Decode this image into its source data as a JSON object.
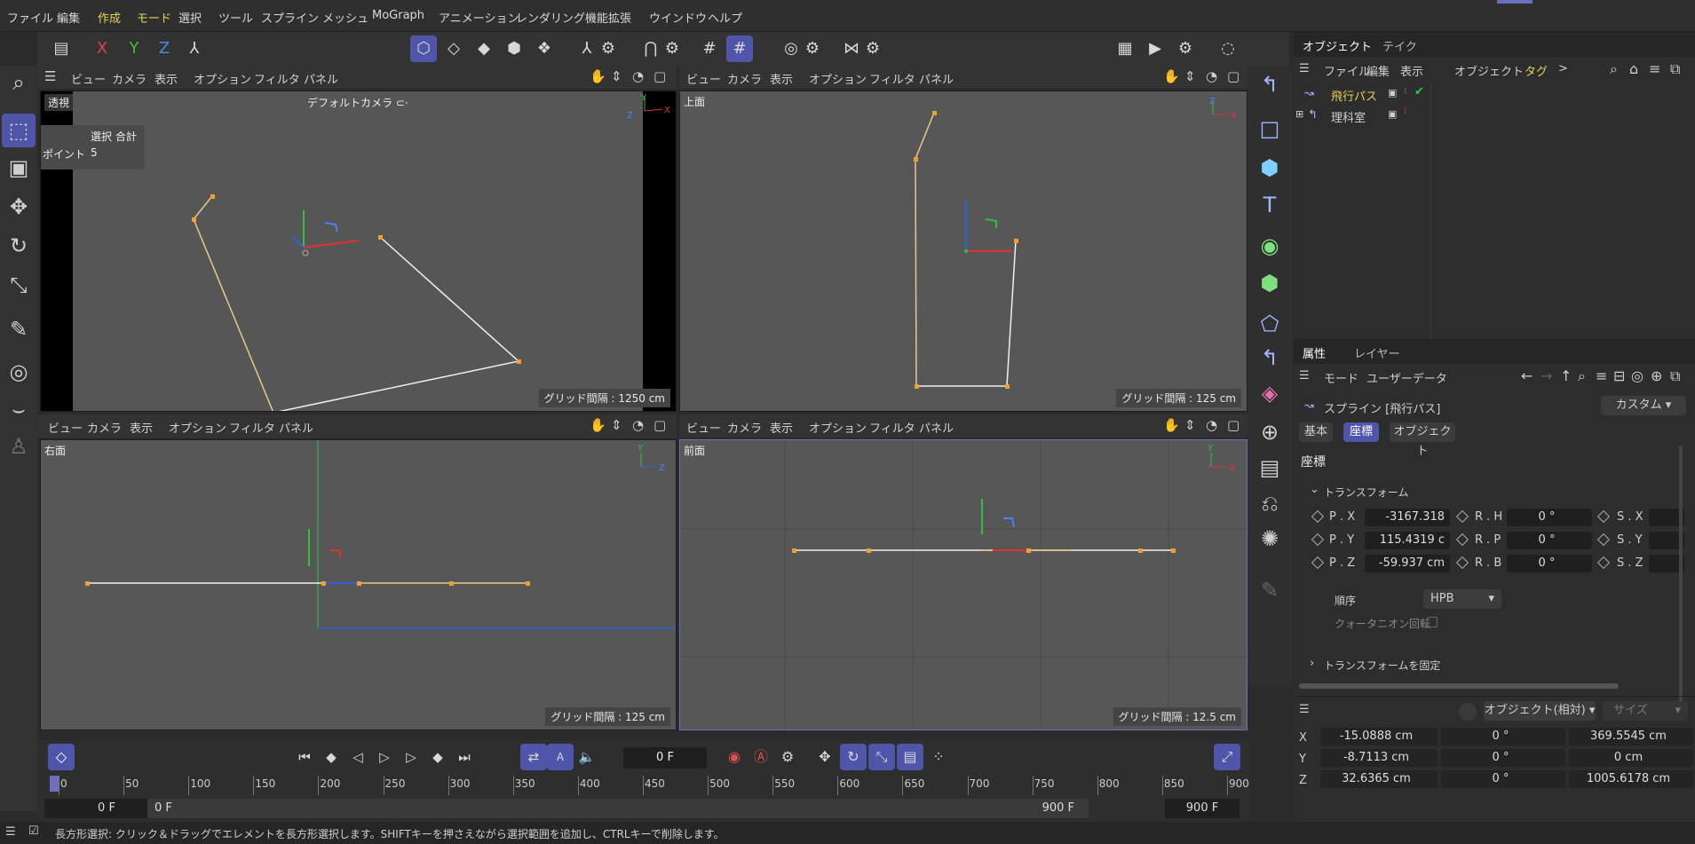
{
  "menu": [
    "ファイル",
    "編集",
    "作成",
    "モード",
    "選択",
    "ツール",
    "スプライン",
    "メッシュ",
    "MoGraph",
    "アニメーション",
    "レンダリング",
    "機能拡張",
    "ウインドウ",
    "ヘルプ"
  ],
  "axes": {
    "x": "X",
    "y": "Y",
    "z": "Z"
  },
  "vpmenu": [
    "ビュー",
    "カメラ",
    "表示",
    "オプション",
    "フィルタ",
    "パネル"
  ],
  "vp1": {
    "label": "透視",
    "camera": "デフォルトカメラ ⊂·",
    "sel_title": "選択 合計",
    "sel_key": "ポイント",
    "sel_val": "5",
    "grid": "グリッド間隔 : 1250 cm"
  },
  "vp2": {
    "label": "上面",
    "grid": "グリッド間隔 : 125 cm"
  },
  "vp3": {
    "label": "右面",
    "grid": "グリッド間隔 : 125 cm"
  },
  "vp4": {
    "label": "前面",
    "grid": "グリッド間隔 : 12.5 cm"
  },
  "objpanel": {
    "tabs": [
      "オブジェクト",
      "テイク"
    ],
    "menu": [
      "ファイル",
      "編集",
      "表示",
      "オブジェクト",
      "タグ"
    ],
    "more": ">",
    "items": [
      "飛行パス",
      "理科室"
    ]
  },
  "attr": {
    "tabs": [
      "属性",
      "レイヤー"
    ],
    "menu": [
      "モード",
      "ユーザーデータ"
    ],
    "title": "スプライン [飛行パス]",
    "preset": "カスタム",
    "subtabs": [
      "基本",
      "座標",
      "オブジェクト"
    ],
    "section": "座標",
    "group": "トランスフォーム",
    "px_l": "P . X",
    "px": "-3167.318",
    "py_l": "P . Y",
    "py": "115.4319 c",
    "pz_l": "P . Z",
    "pz": "-59.937 cm",
    "rh_l": "R . H",
    "rh": "0 °",
    "rp_l": "R . P",
    "rp": "0 °",
    "rb_l": "R . B",
    "rb": "0 °",
    "sx_l": "S . X",
    "sy_l": "S . Y",
    "sz_l": "S . Z",
    "order_l": "順序",
    "order": "HPB",
    "quat": "クォータニオン回転",
    "freeze": "トランスフォームを固定"
  },
  "coord": {
    "mode": "オブジェクト(相対)",
    "size": "サイズ",
    "rows": [
      [
        "X",
        "-15.0888 cm",
        "0 °",
        "369.5545 cm"
      ],
      [
        "Y",
        "-8.7113 cm",
        "0 °",
        "0 cm"
      ],
      [
        "Z",
        "32.6365 cm",
        "0 °",
        "1005.6178 cm"
      ]
    ]
  },
  "timeline": {
    "frame": "0 F",
    "ticks": [
      "0",
      "50",
      "100",
      "150",
      "200",
      "250",
      "300",
      "350",
      "400",
      "450",
      "500",
      "550",
      "600",
      "650",
      "700",
      "750",
      "800",
      "850",
      "900"
    ],
    "start": "0 F",
    "cur": "0 F",
    "end": "900 F",
    "end2": "900 F"
  },
  "status": "長方形選択: クリック＆ドラッグでエレメントを長方形選択します。SHIFTキーを押さえながら選択範囲を追加し、CTRLキーで削除します。",
  "colors": {
    "accent": "#4f55a8",
    "spline": "#e8c88a",
    "point": "#f0a030",
    "active_menu": "#e8d15a"
  }
}
